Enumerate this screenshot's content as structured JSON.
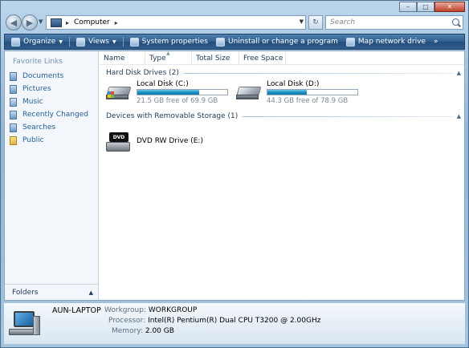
{
  "address": {
    "location": "Computer",
    "search_placeholder": "Search"
  },
  "toolbar": {
    "organize": "Organize",
    "views": "Views",
    "system_properties": "System properties",
    "uninstall": "Uninstall or change a program",
    "map_drive": "Map network drive",
    "more": "»"
  },
  "nav": {
    "favorite_links_title": "Favorite Links",
    "items": [
      {
        "label": "Documents",
        "icon": "documents-icon"
      },
      {
        "label": "Pictures",
        "icon": "pictures-icon"
      },
      {
        "label": "Music",
        "icon": "music-icon"
      },
      {
        "label": "Recently Changed",
        "icon": "recently-changed-icon"
      },
      {
        "label": "Searches",
        "icon": "searches-icon"
      },
      {
        "label": "Public",
        "icon": "public-folder-icon"
      }
    ],
    "folders_label": "Folders"
  },
  "columns": [
    "Name",
    "Type",
    "Total Size",
    "Free Space"
  ],
  "groups": {
    "hard_disks": "Hard Disk Drives (2)",
    "removable": "Devices with Removable Storage (1)"
  },
  "drives": [
    {
      "label": "Local Disk (C:)",
      "free_text": "21.5 GB free of 69.9 GB",
      "used_fraction": 0.69
    },
    {
      "label": "Local Disk (D:)",
      "free_text": "44.3 GB free of 78.9 GB",
      "used_fraction": 0.44
    }
  ],
  "dvd": {
    "label": "DVD RW Drive (E:)",
    "disc_text": "DVD"
  },
  "details": {
    "computer_name": "AUN-LAPTOP",
    "workgroup_key": "Workgroup:",
    "workgroup_val": "WORKGROUP",
    "processor_key": "Processor:",
    "processor_val": "Intel(R) Pentium(R) Dual  CPU  T3200  @ 2.00GHz",
    "memory_key": "Memory:",
    "memory_val": "2.00 GB"
  },
  "window_controls": {
    "minimize": "–",
    "maximize": "□",
    "close": "✕"
  },
  "colors": {
    "toolbar": "#315f8f",
    "link": "#1f5fa3",
    "drive_fill": "#1d8fc0"
  }
}
